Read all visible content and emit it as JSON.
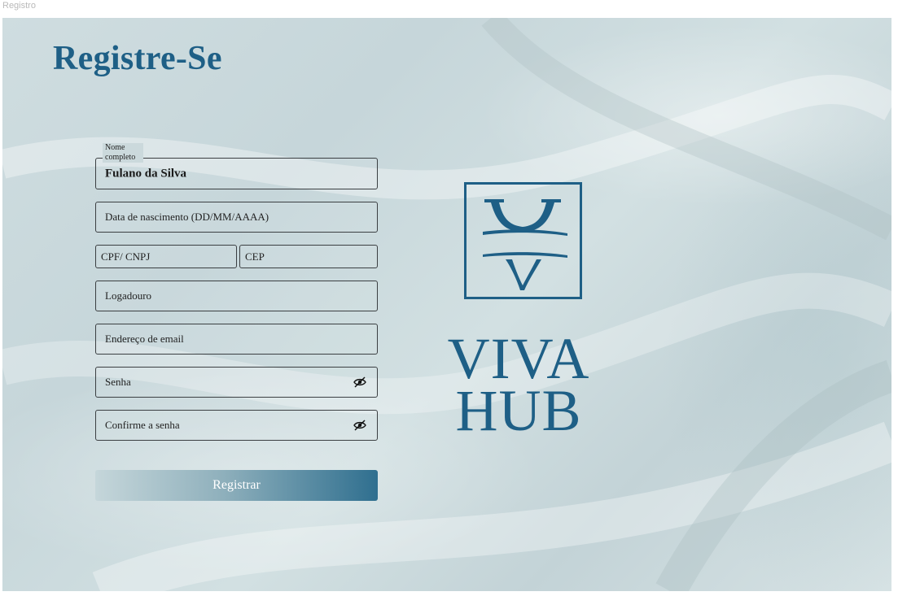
{
  "window": {
    "title": "Registro"
  },
  "page": {
    "heading": "Registre-Se"
  },
  "form": {
    "full_name": {
      "label": "Nome completo",
      "value": "Fulano da Silva"
    },
    "birth_date": {
      "placeholder": "Data de nascimento (DD/MM/AAAA)"
    },
    "cpf": {
      "placeholder": "CPF/ CNPJ"
    },
    "cep": {
      "placeholder": "CEP"
    },
    "street": {
      "placeholder": "Logadouro"
    },
    "email": {
      "placeholder": "Endereço de email"
    },
    "password": {
      "placeholder": "Senha",
      "icon": "eye-off-icon"
    },
    "confirm_password": {
      "placeholder": "Confirme a senha",
      "icon": "eye-off-icon"
    },
    "submit_label": "Registrar"
  },
  "brand": {
    "line1": "VIVA",
    "line2": "HUB"
  },
  "colors": {
    "brand_blue": "#1e5f86",
    "background": "#cbd9dc",
    "field_border": "#3b3f42",
    "button_gradient_start": "#c5d6da",
    "button_gradient_end": "#2f6f8f"
  }
}
